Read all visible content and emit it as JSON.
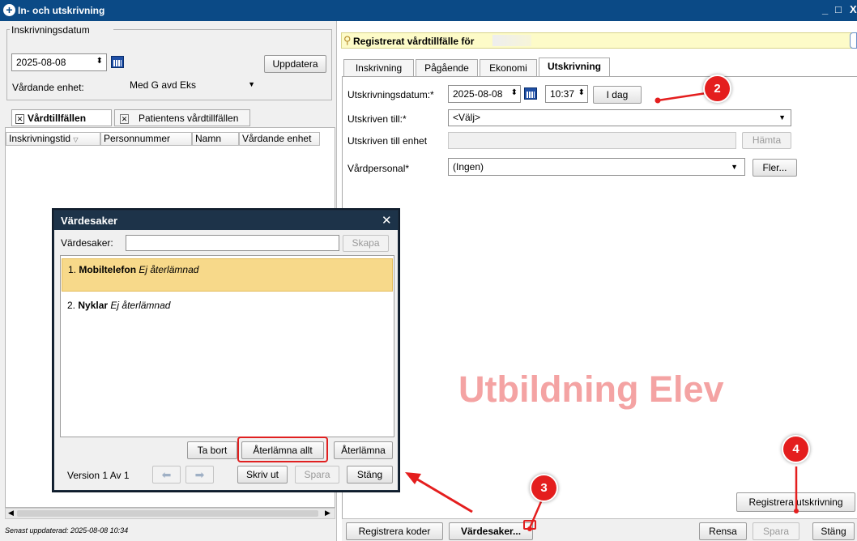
{
  "window": {
    "title": "In- och utskrivning",
    "controls": [
      "_",
      "□",
      "X"
    ]
  },
  "left": {
    "group_title": "Inskrivningsdatum",
    "date": "2025-08-08",
    "update_button": "Uppdatera",
    "unit_label": "Vårdande enhet:",
    "unit_value": "Med G avd Eks",
    "tabs": [
      "Vårdtillfällen",
      "Patientens vårdtillfällen"
    ],
    "columns": [
      "Inskrivningstid",
      "Personnummer",
      "Namn",
      "Vårdande enhet"
    ],
    "footer": "Senast uppdaterad: 2025-08-08 10:34"
  },
  "right": {
    "header": "Registrerat vårdtillfälle för",
    "tabs": [
      "Inskrivning",
      "Pågående",
      "Ekonomi",
      "Utskrivning"
    ],
    "active_tab": "Utskrivning",
    "fields": {
      "date_label": "Utskrivningsdatum:*",
      "date_value": "2025-08-08",
      "time_value": "10:37",
      "today_button": "I dag",
      "to_label": "Utskriven till:*",
      "to_value": "<Välj>",
      "unit_label": "Utskriven till enhet",
      "fetch_button": "Hämta",
      "staff_label": "Vårdpersonal*",
      "staff_value": "(Ingen)",
      "more_button": "Fler..."
    },
    "watermark": "Utbildning Elev",
    "register_discharge_button": "Registrera utskrivning",
    "bottom_buttons": {
      "codes": "Registrera koder",
      "valuables": "Värdesaker...",
      "clear": "Rensa",
      "save": "Spara",
      "close": "Stäng"
    }
  },
  "dialog": {
    "title": "Värdesaker",
    "input_label": "Värdesaker:",
    "input_value": "",
    "create_button": "Skapa",
    "items": [
      {
        "num": "1.",
        "name": "Mobiltelefon",
        "status": "Ej återlämnad"
      },
      {
        "num": "2.",
        "name": "Nyklar",
        "status": "Ej återlämnad"
      }
    ],
    "remove_button": "Ta bort",
    "return_all_button": "Återlämna allt",
    "return_button": "Återlämna",
    "version_label": "Version",
    "version_current": "1",
    "version_of": "Av",
    "version_total": "1",
    "print_button": "Skriv ut",
    "save_button": "Spara",
    "close_button": "Stäng"
  },
  "callouts": [
    "2",
    "3",
    "4"
  ],
  "colors": {
    "accent": "#0b4a86",
    "highlight": "#f7d98a",
    "annotation": "#e41e1e",
    "watermark": "#f4a3a3"
  }
}
